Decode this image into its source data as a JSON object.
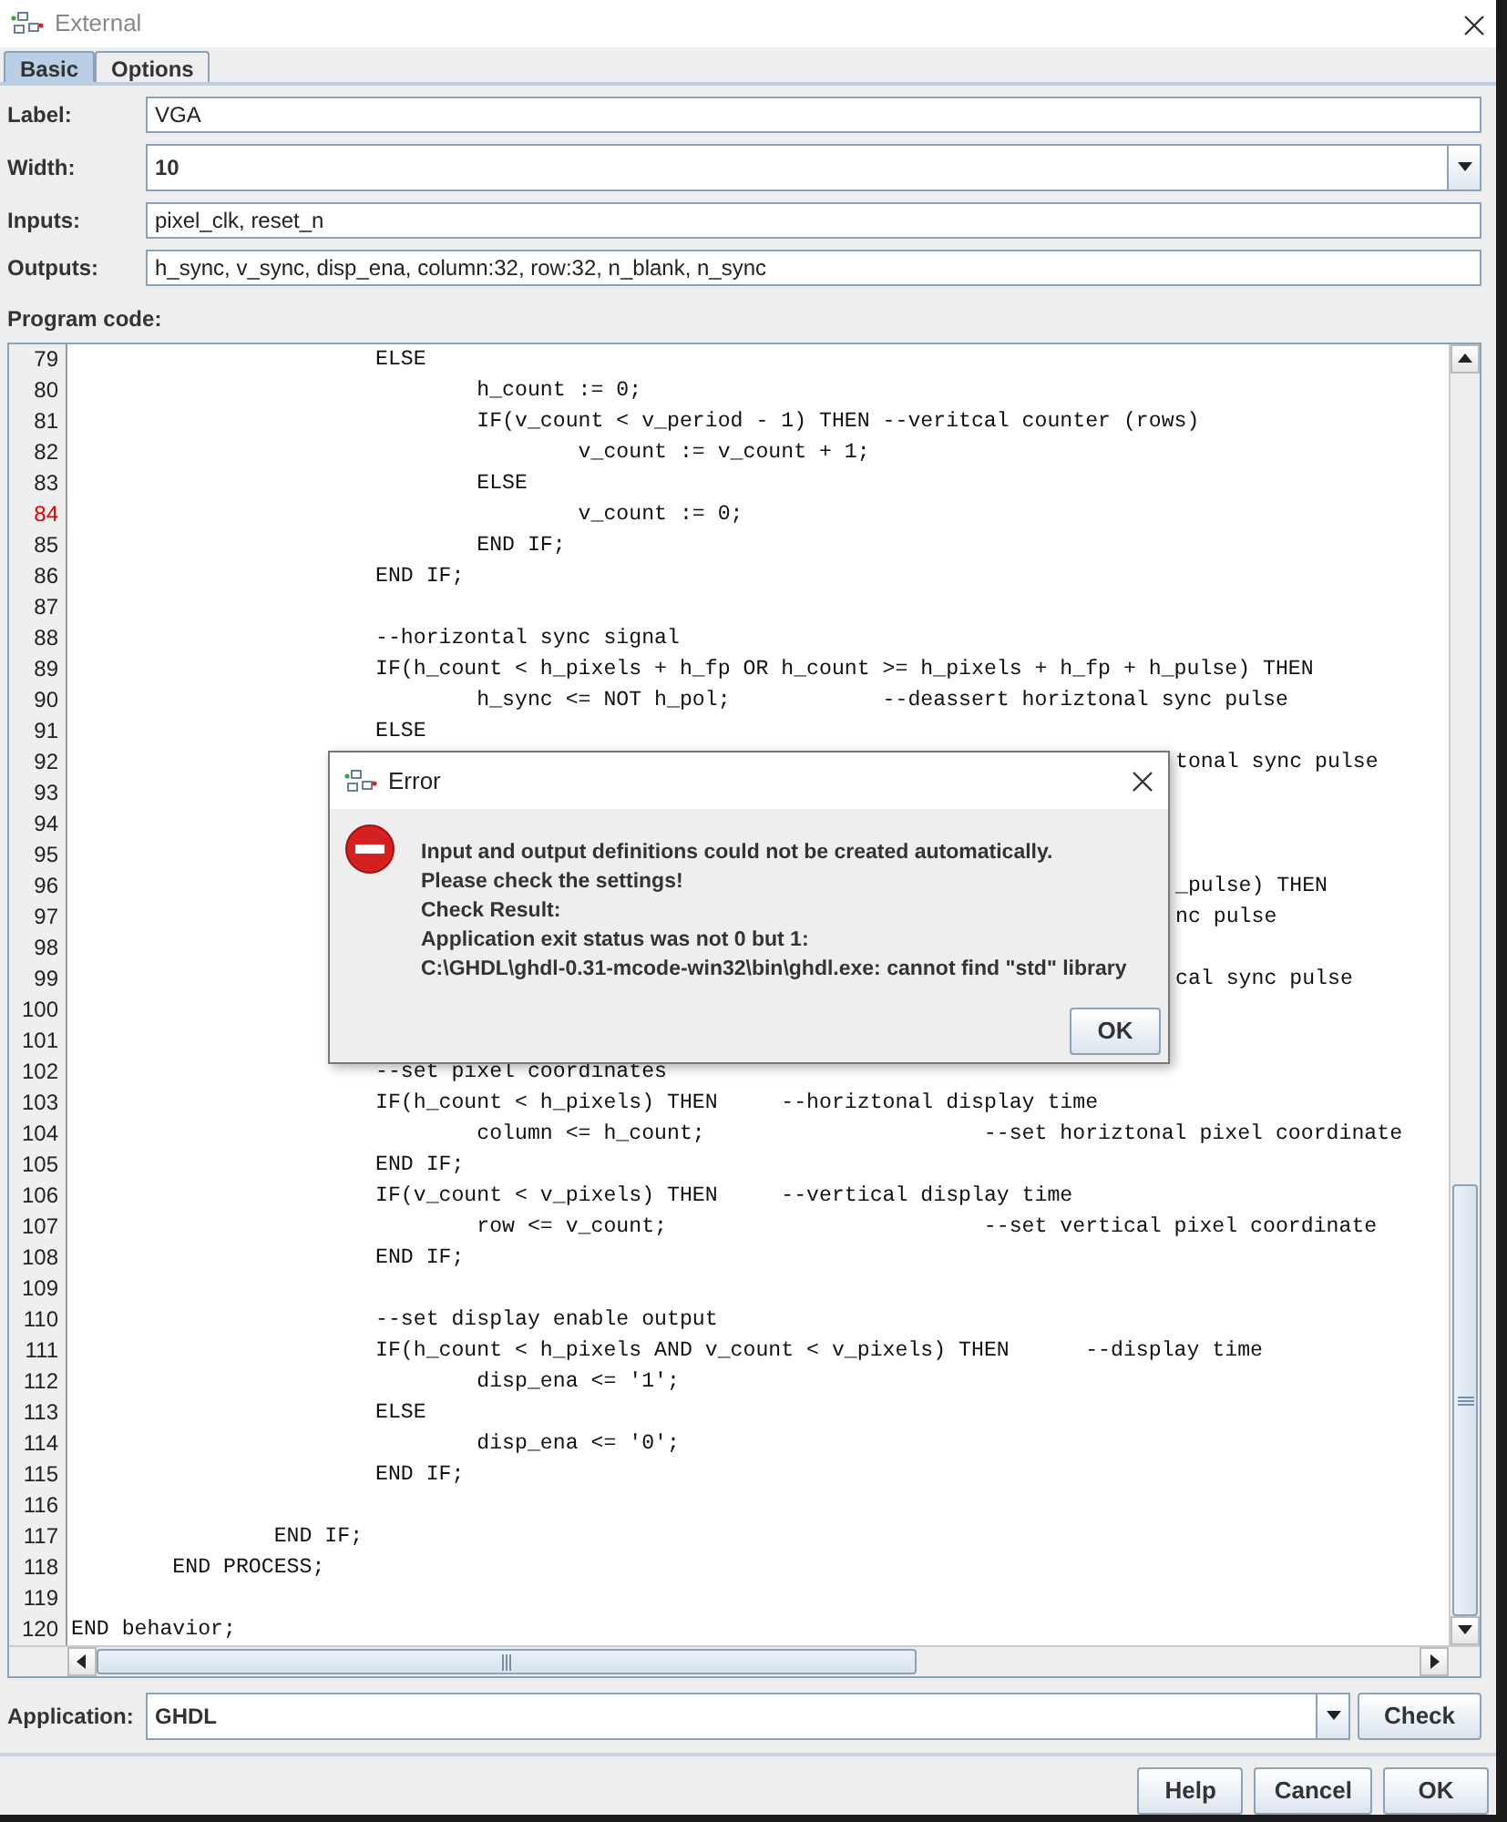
{
  "window": {
    "title": "External"
  },
  "tabs": [
    {
      "label": "Basic",
      "selected": true
    },
    {
      "label": "Options",
      "selected": false
    }
  ],
  "fields": [
    {
      "label": "Label:",
      "value": "VGA",
      "kind": "text"
    },
    {
      "label": "Width:",
      "value": "10",
      "kind": "combo"
    },
    {
      "label": "Inputs:",
      "value": "pixel_clk, reset_n",
      "kind": "text"
    },
    {
      "label": "Outputs:",
      "value": "h_sync, v_sync, disp_ena, column:32, row:32, n_blank, n_sync",
      "kind": "text"
    }
  ],
  "code_label": "Program code:",
  "code_lines": [
    {
      "number": "79",
      "text": "\t\t\tELSE",
      "marked": false
    },
    {
      "number": "80",
      "text": "\t\t\t\th_count := 0;",
      "marked": false
    },
    {
      "number": "81",
      "text": "\t\t\t\tIF(v_count < v_period - 1) THEN --veritcal counter (rows)",
      "marked": false
    },
    {
      "number": "82",
      "text": "\t\t\t\t\tv_count := v_count + 1;",
      "marked": false
    },
    {
      "number": "83",
      "text": "\t\t\t\tELSE",
      "marked": false
    },
    {
      "number": "84",
      "text": "\t\t\t\t\tv_count := 0;",
      "marked": true
    },
    {
      "number": "85",
      "text": "\t\t\t\tEND IF;",
      "marked": false
    },
    {
      "number": "86",
      "text": "\t\t\tEND IF;",
      "marked": false
    },
    {
      "number": "87",
      "marked": false
    },
    {
      "number": "88",
      "text": "\t\t\t--horizontal sync signal",
      "marked": false
    },
    {
      "number": "89",
      "text": "\t\t\tIF(h_count < h_pixels + h_fp OR h_count >= h_pixels + h_fp + h_pulse) THEN",
      "marked": false
    },
    {
      "number": "90",
      "text": "\t\t\t\th_sync <= NOT h_pol;            --deassert horiztonal sync pulse",
      "marked": false
    },
    {
      "number": "91",
      "text": "\t\t\tELSE",
      "marked": false
    },
    {
      "number": "92",
      "text": "tonal sync pulse",
      "kind": "tail",
      "marked": false
    },
    {
      "number": "93",
      "marked": false
    },
    {
      "number": "94",
      "marked": false
    },
    {
      "number": "95",
      "marked": false
    },
    {
      "number": "96",
      "text": "_pulse) THEN",
      "kind": "tail",
      "marked": false
    },
    {
      "number": "97",
      "text": "nc pulse",
      "kind": "tail",
      "marked": false
    },
    {
      "number": "98",
      "marked": false
    },
    {
      "number": "99",
      "text": "cal sync pulse",
      "kind": "tail",
      "marked": false
    },
    {
      "number": "100",
      "marked": false
    },
    {
      "number": "101",
      "marked": false
    },
    {
      "number": "102",
      "text": "\t\t\t--set pixel coordinates",
      "marked": false
    },
    {
      "number": "103",
      "text": "\t\t\tIF(h_count < h_pixels) THEN     --horiztonal display time",
      "marked": false
    },
    {
      "number": "104",
      "text": "\t\t\t\tcolumn <= h_count;                      --set horiztonal pixel coordinate",
      "marked": false
    },
    {
      "number": "105",
      "text": "\t\t\tEND IF;",
      "marked": false
    },
    {
      "number": "106",
      "text": "\t\t\tIF(v_count < v_pixels) THEN     --vertical display time",
      "marked": false
    },
    {
      "number": "107",
      "text": "\t\t\t\trow <= v_count;                         --set vertical pixel coordinate",
      "marked": false
    },
    {
      "number": "108",
      "text": "\t\t\tEND IF;",
      "marked": false
    },
    {
      "number": "109",
      "marked": false
    },
    {
      "number": "110",
      "text": "\t\t\t--set display enable output",
      "marked": false
    },
    {
      "number": "111",
      "text": "\t\t\tIF(h_count < h_pixels AND v_count < v_pixels) THEN      --display time",
      "marked": false
    },
    {
      "number": "112",
      "text": "\t\t\t\tdisp_ena <= '1';",
      "marked": false
    },
    {
      "number": "113",
      "text": "\t\t\tELSE",
      "marked": false
    },
    {
      "number": "114",
      "text": "\t\t\t\tdisp_ena <= '0';",
      "marked": false
    },
    {
      "number": "115",
      "text": "\t\t\tEND IF;",
      "marked": false
    },
    {
      "number": "116",
      "marked": false
    },
    {
      "number": "117",
      "text": "\t\tEND IF;",
      "marked": false
    },
    {
      "number": "118",
      "text": "\tEND PROCESS;",
      "marked": false
    },
    {
      "number": "119",
      "marked": false
    },
    {
      "number": "120",
      "text": "END behavior;",
      "marked": false
    }
  ],
  "application": {
    "label": "Application:",
    "value": "GHDL",
    "button": "Check"
  },
  "buttons": [
    "Help",
    "Cancel",
    "OK"
  ],
  "dialog": {
    "title": "Error",
    "message": [
      "Input and output definitions could not be created automatically.",
      "Please check the settings!",
      "Check Result:",
      "Application exit status was not 0 but 1:",
      "C:\\GHDL\\ghdl-0.31-mcode-win32\\bin\\ghdl.exe: cannot find \"std\" library"
    ],
    "button": "OK"
  }
}
